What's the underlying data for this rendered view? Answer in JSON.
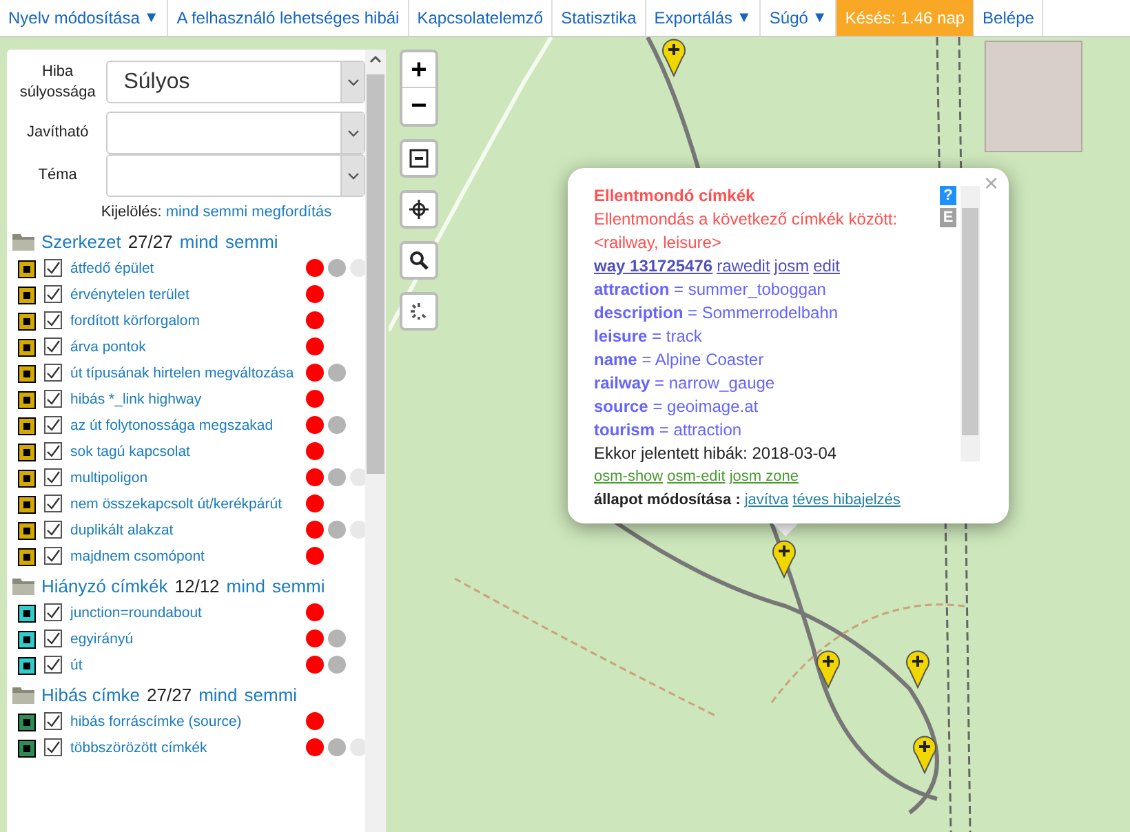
{
  "nav": [
    {
      "label": "Nyelv módosítása",
      "dropdown": true,
      "highlight": false
    },
    {
      "label": "A felhasználó lehetséges hibái",
      "dropdown": false,
      "highlight": false
    },
    {
      "label": "Kapcsolatelemző",
      "dropdown": false,
      "highlight": false
    },
    {
      "label": "Statisztika",
      "dropdown": false,
      "highlight": false
    },
    {
      "label": "Exportálás",
      "dropdown": true,
      "highlight": false
    },
    {
      "label": "Súgó",
      "dropdown": true,
      "highlight": false
    },
    {
      "label": "Késés: 1.46 nap",
      "dropdown": false,
      "highlight": true
    },
    {
      "label": "Belépe",
      "dropdown": false,
      "highlight": false
    }
  ],
  "dropdown_mark": "▼",
  "filters": [
    {
      "label": "Hiba súlyossága",
      "value": "Súlyos"
    },
    {
      "label": "Javítható"
    },
    {
      "label": "Téma"
    }
  ],
  "selection": {
    "label": "Kijelölés:",
    "links": [
      "mind",
      "semmi",
      "megfordítás"
    ]
  },
  "groups": [
    {
      "name": "Szerkezet",
      "count": "27/27",
      "links": [
        "mind",
        "semmi"
      ],
      "color": "#d4aa00",
      "items": [
        {
          "label": "átfedő épület",
          "checked": true,
          "dots": [
            {
              "color": "#ff0000"
            },
            {
              "color": "#b4b4b4"
            },
            {
              "color": "#e8e8e8"
            }
          ]
        },
        {
          "label": "érvénytelen terület",
          "checked": true,
          "dots": [
            {
              "color": "#ff0000"
            }
          ]
        },
        {
          "label": "fordított körforgalom",
          "checked": true,
          "dots": [
            {
              "color": "#ff0000"
            }
          ]
        },
        {
          "label": "árva pontok",
          "checked": true,
          "dots": [
            {
              "color": "#ff0000"
            }
          ]
        },
        {
          "label": "út típusának hirtelen megváltozása",
          "checked": true,
          "dots": [
            {
              "color": "#ff0000"
            },
            {
              "color": "#b4b4b4"
            }
          ]
        },
        {
          "label": "hibás *_link highway",
          "checked": true,
          "dots": [
            {
              "color": "#ff0000"
            }
          ]
        },
        {
          "label": "az út folytonossága megszakad",
          "checked": true,
          "dots": [
            {
              "color": "#ff0000"
            },
            {
              "color": "#b4b4b4"
            }
          ]
        },
        {
          "label": "sok tagú kapcsolat",
          "checked": true,
          "dots": [
            {
              "color": "#ff0000"
            }
          ]
        },
        {
          "label": "multipoligon",
          "checked": true,
          "dots": [
            {
              "color": "#ff0000"
            },
            {
              "color": "#b4b4b4"
            },
            {
              "color": "#e8e8e8"
            }
          ]
        },
        {
          "label": "nem összekapcsolt út/kerékpárút",
          "checked": true,
          "dots": [
            {
              "color": "#ff0000"
            }
          ]
        },
        {
          "label": "duplikált alakzat",
          "checked": true,
          "dots": [
            {
              "color": "#ff0000"
            },
            {
              "color": "#b4b4b4"
            },
            {
              "color": "#e8e8e8"
            }
          ]
        },
        {
          "label": "majdnem csomópont",
          "checked": true,
          "dots": [
            {
              "color": "#ff0000"
            }
          ]
        }
      ]
    },
    {
      "name": "Hiányzó címkék",
      "count": "12/12",
      "links": [
        "mind",
        "semmi"
      ],
      "color": "#33cccc",
      "items": [
        {
          "label": "junction=roundabout",
          "checked": true,
          "dots": [
            {
              "color": "#ff0000"
            }
          ]
        },
        {
          "label": "egyirányú",
          "checked": true,
          "dots": [
            {
              "color": "#ff0000"
            },
            {
              "color": "#b4b4b4"
            }
          ]
        },
        {
          "label": "út",
          "checked": true,
          "dots": [
            {
              "color": "#ff0000"
            },
            {
              "color": "#b4b4b4"
            }
          ]
        }
      ]
    },
    {
      "name": "Hibás címke",
      "count": "27/27",
      "links": [
        "mind",
        "semmi"
      ],
      "color": "#2e8b57",
      "items": [
        {
          "label": "hibás forráscímke (source)",
          "checked": true,
          "dots": [
            {
              "color": "#ff0000"
            }
          ]
        },
        {
          "label": "többszörözött címkék",
          "checked": true,
          "dots": [
            {
              "color": "#ff0000"
            },
            {
              "color": "#b4b4b4"
            },
            {
              "color": "#e8e8e8"
            }
          ]
        }
      ]
    }
  ],
  "map_controls": {
    "zoom_in": "+",
    "zoom_out": "−"
  },
  "popup": {
    "title": "Ellentmondó címkék",
    "message": "Ellentmondás a következő címkék között:",
    "conflict": "<railway, leisure>",
    "object_link": "way 131725476",
    "object_actions": [
      "rawedit",
      "josm",
      "edit"
    ],
    "tags": [
      {
        "key": "attraction",
        "sep": "=",
        "value": "summer_toboggan"
      },
      {
        "key": "description",
        "sep": "=",
        "value": "Sommerrodelbahn"
      },
      {
        "key": "leisure",
        "sep": "=",
        "value": "track"
      },
      {
        "key": "name",
        "sep": "=",
        "value": "Alpine Coaster"
      },
      {
        "key": "railway",
        "sep": "=",
        "value": "narrow_gauge"
      },
      {
        "key": "source",
        "sep": "=",
        "value": "geoimage.at"
      },
      {
        "key": "tourism",
        "sep": "=",
        "value": "attraction"
      }
    ],
    "reported": "Ekkor jelentett hibák: 2018-03-04",
    "osm_links": [
      "osm-show",
      "osm-edit",
      "josm zone"
    ],
    "status_label": "állapot módosítása :",
    "status_links": [
      "javítva",
      "téves hibajelzés"
    ],
    "help": "?",
    "export": "E",
    "close": "×"
  }
}
